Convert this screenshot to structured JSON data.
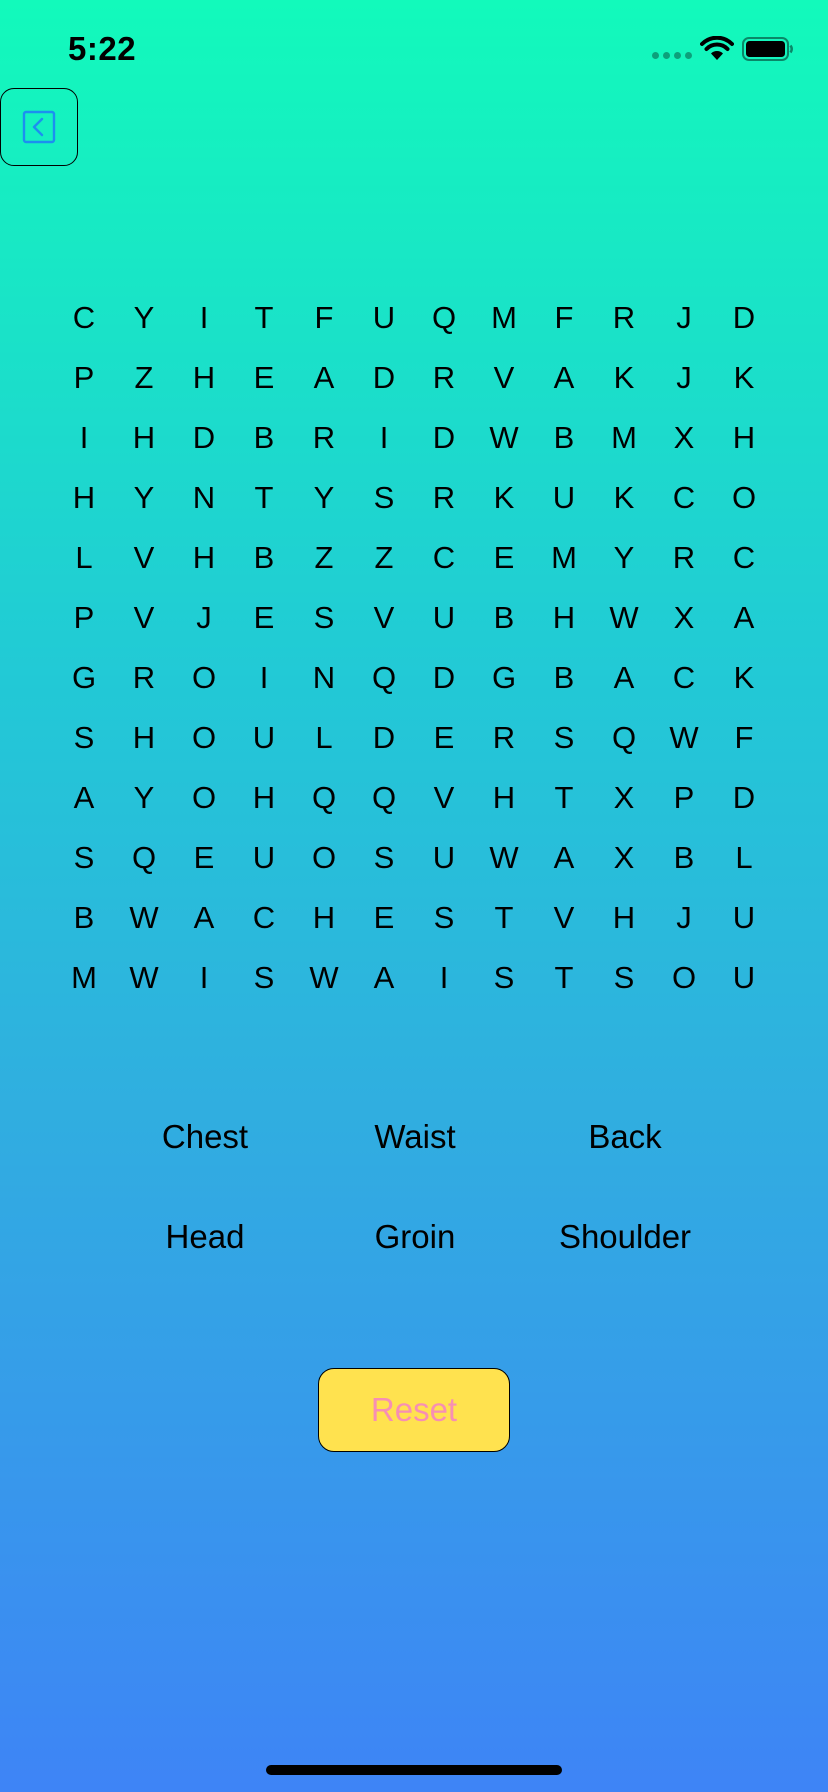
{
  "status_bar": {
    "time": "5:22",
    "icons": [
      "signal-dots-icon",
      "wifi-icon",
      "battery-icon"
    ]
  },
  "back_button": {
    "icon": "chevron-left-icon"
  },
  "grid": [
    [
      "C",
      "Y",
      "I",
      "T",
      "F",
      "U",
      "Q",
      "M",
      "F",
      "R",
      "J",
      "D"
    ],
    [
      "P",
      "Z",
      "H",
      "E",
      "A",
      "D",
      "R",
      "V",
      "A",
      "K",
      "J",
      "K"
    ],
    [
      "I",
      "H",
      "D",
      "B",
      "R",
      "I",
      "D",
      "W",
      "B",
      "M",
      "X",
      "H"
    ],
    [
      "H",
      "Y",
      "N",
      "T",
      "Y",
      "S",
      "R",
      "K",
      "U",
      "K",
      "C",
      "O"
    ],
    [
      "L",
      "V",
      "H",
      "B",
      "Z",
      "Z",
      "C",
      "E",
      "M",
      "Y",
      "R",
      "C"
    ],
    [
      "P",
      "V",
      "J",
      "E",
      "S",
      "V",
      "U",
      "B",
      "H",
      "W",
      "X",
      "A"
    ],
    [
      "G",
      "R",
      "O",
      "I",
      "N",
      "Q",
      "D",
      "G",
      "B",
      "A",
      "C",
      "K"
    ],
    [
      "S",
      "H",
      "O",
      "U",
      "L",
      "D",
      "E",
      "R",
      "S",
      "Q",
      "W",
      "F"
    ],
    [
      "A",
      "Y",
      "O",
      "H",
      "Q",
      "Q",
      "V",
      "H",
      "T",
      "X",
      "P",
      "D"
    ],
    [
      "S",
      "Q",
      "E",
      "U",
      "O",
      "S",
      "U",
      "W",
      "A",
      "X",
      "B",
      "L"
    ],
    [
      "B",
      "W",
      "A",
      "C",
      "H",
      "E",
      "S",
      "T",
      "V",
      "H",
      "J",
      "U"
    ],
    [
      "M",
      "W",
      "I",
      "S",
      "W",
      "A",
      "I",
      "S",
      "T",
      "S",
      "O",
      "U"
    ]
  ],
  "words": [
    "Chest",
    "Waist",
    "Back",
    "Head",
    "Groin",
    "Shoulder"
  ],
  "reset_button": {
    "label": "Reset",
    "text_color": "#f78fb3",
    "background": "#ffe24f"
  },
  "colors": {
    "gradient_top": "#12fabb",
    "gradient_bottom": "#3e84f6",
    "back_icon": "#1c8ff0"
  }
}
